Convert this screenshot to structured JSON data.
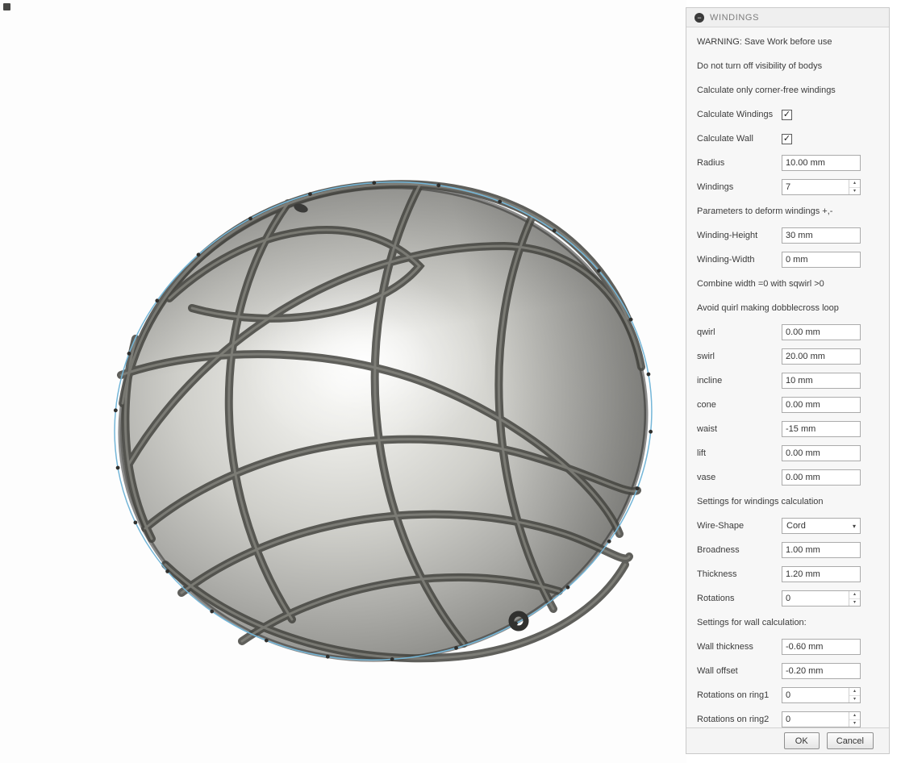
{
  "dialog": {
    "title": "WINDINGS",
    "rows": [
      {
        "type": "note",
        "label": "WARNING: Save Work before use"
      },
      {
        "type": "note",
        "label": "Do not turn off visibility of bodys"
      },
      {
        "type": "note",
        "label": "Calculate only corner-free windings"
      },
      {
        "type": "checkbox",
        "label": "Calculate Windings",
        "checked": true
      },
      {
        "type": "checkbox",
        "label": "Calculate Wall",
        "checked": true
      },
      {
        "type": "input",
        "label": "Radius",
        "value": "10.00 mm"
      },
      {
        "type": "spinner",
        "label": "Windings",
        "value": "7"
      },
      {
        "type": "note",
        "label": "Parameters to deform windings +,-"
      },
      {
        "type": "input",
        "label": "Winding-Height",
        "value": "30 mm"
      },
      {
        "type": "input",
        "label": "Winding-Width",
        "value": "0 mm"
      },
      {
        "type": "note",
        "label": "Combine width =0 with sqwirl >0"
      },
      {
        "type": "note",
        "label": "Avoid quirl making dobblecross loop"
      },
      {
        "type": "input",
        "label": "qwirl",
        "value": "0.00 mm"
      },
      {
        "type": "input",
        "label": "swirl",
        "value": "20.00 mm"
      },
      {
        "type": "input",
        "label": "incline",
        "value": "10 mm"
      },
      {
        "type": "input",
        "label": "cone",
        "value": "0.00 mm"
      },
      {
        "type": "input",
        "label": "waist",
        "value": "-15 mm"
      },
      {
        "type": "input",
        "label": "lift",
        "value": "0.00 mm"
      },
      {
        "type": "input",
        "label": "vase",
        "value": "0.00 mm"
      },
      {
        "type": "note",
        "label": "Settings for windings calculation"
      },
      {
        "type": "select",
        "label": "Wire-Shape",
        "value": "Cord"
      },
      {
        "type": "input",
        "label": "Broadness",
        "value": "1.00 mm"
      },
      {
        "type": "input",
        "label": "Thickness",
        "value": "1.20 mm"
      },
      {
        "type": "spinner",
        "label": "Rotations",
        "value": "0"
      },
      {
        "type": "note",
        "label": "Settings for wall calculation:"
      },
      {
        "type": "input",
        "label": "Wall thickness",
        "value": "-0.60 mm"
      },
      {
        "type": "input",
        "label": "Wall offset",
        "value": "-0.20 mm"
      },
      {
        "type": "spinner",
        "label": "Rotations on ring1",
        "value": "0"
      },
      {
        "type": "spinner",
        "label": "Rotations on ring2",
        "value": "0"
      }
    ],
    "footer": {
      "ok_label": "OK",
      "cancel_label": "Cancel"
    }
  },
  "icons": {
    "collapse": "−",
    "check": "✓",
    "chevron_down": "▾",
    "spin_up": "▴",
    "spin_down": "▾"
  },
  "colors": {
    "sketch_accent": "#74b6d8",
    "winding_tube": "#44443f",
    "panel_border": "#c9c9c9"
  }
}
